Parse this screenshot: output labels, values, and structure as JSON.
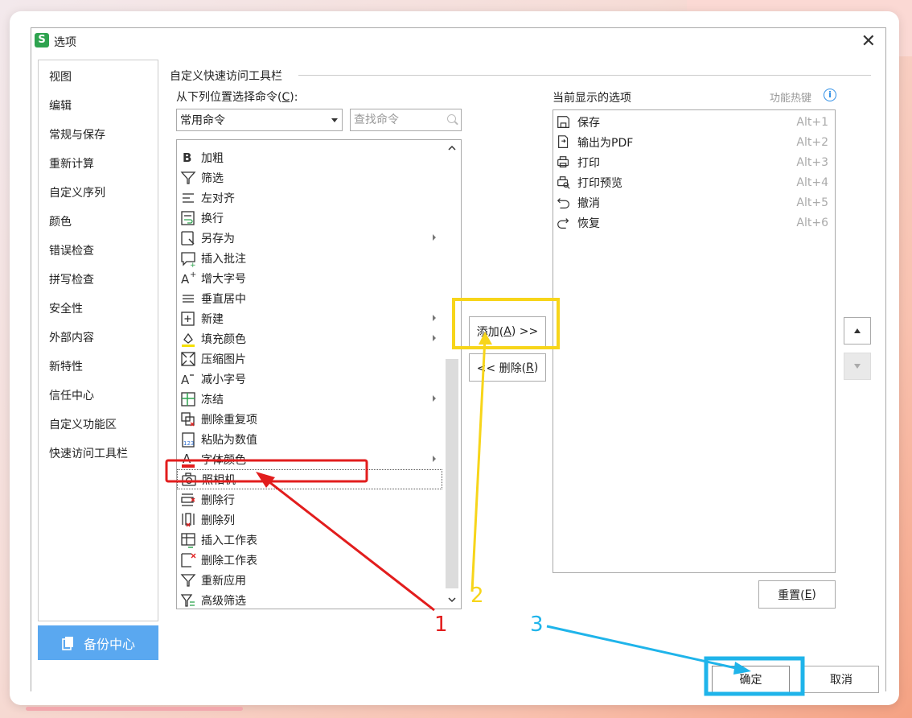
{
  "dialog": {
    "title": "选项",
    "app_icon_letter": "S",
    "close": "✕"
  },
  "nav": {
    "items": [
      "视图",
      "编辑",
      "常规与保存",
      "重新计算",
      "自定义序列",
      "颜色",
      "错误检查",
      "拼写检查",
      "安全性",
      "外部内容",
      "新特性",
      "信任中心",
      "自定义功能区",
      "快速访问工具栏"
    ],
    "backup_label": "备份中心"
  },
  "section": {
    "title": "自定义快速访问工具栏",
    "from_label_prefix": "从下列位置选择命令(",
    "from_label_key": "C",
    "from_label_suffix": "):",
    "combo_value": "常用命令",
    "search_placeholder": "查找命令",
    "current_label": "当前显示的选项",
    "hotkey_label": "功能热键",
    "info": "i"
  },
  "commands": [
    {
      "label": "加粗",
      "icon": "bold-icon",
      "submenu": false
    },
    {
      "label": "筛选",
      "icon": "filter-icon",
      "submenu": false
    },
    {
      "label": "左对齐",
      "icon": "align-left-icon",
      "submenu": false
    },
    {
      "label": "换行",
      "icon": "wrap-text-icon",
      "submenu": false
    },
    {
      "label": "另存为",
      "icon": "save-as-icon",
      "submenu": true
    },
    {
      "label": "插入批注",
      "icon": "comment-icon",
      "submenu": false
    },
    {
      "label": "增大字号",
      "icon": "font-increase-icon",
      "submenu": false
    },
    {
      "label": "垂直居中",
      "icon": "vertical-center-icon",
      "submenu": false
    },
    {
      "label": "新建",
      "icon": "new-icon",
      "submenu": true
    },
    {
      "label": "填充颜色",
      "icon": "fill-color-icon",
      "submenu": true
    },
    {
      "label": "压缩图片",
      "icon": "compress-image-icon",
      "submenu": false
    },
    {
      "label": "减小字号",
      "icon": "font-decrease-icon",
      "submenu": false
    },
    {
      "label": "冻结",
      "icon": "freeze-icon",
      "submenu": true
    },
    {
      "label": "删除重复项",
      "icon": "remove-duplicates-icon",
      "submenu": false
    },
    {
      "label": "粘贴为数值",
      "icon": "paste-values-icon",
      "submenu": false
    },
    {
      "label": "字体颜色",
      "icon": "font-color-icon",
      "submenu": true
    },
    {
      "label": "照相机",
      "icon": "camera-icon",
      "submenu": false
    },
    {
      "label": "删除行",
      "icon": "delete-row-icon",
      "submenu": false
    },
    {
      "label": "删除列",
      "icon": "delete-column-icon",
      "submenu": false
    },
    {
      "label": "插入工作表",
      "icon": "insert-sheet-icon",
      "submenu": false
    },
    {
      "label": "删除工作表",
      "icon": "delete-sheet-icon",
      "submenu": false
    },
    {
      "label": "重新应用",
      "icon": "reapply-icon",
      "submenu": false
    },
    {
      "label": "高级筛选",
      "icon": "advanced-filter-icon",
      "submenu": false
    }
  ],
  "selected_command_index": 16,
  "current": [
    {
      "label": "保存",
      "key": "Alt+1",
      "icon": "save-icon"
    },
    {
      "label": "输出为PDF",
      "key": "Alt+2",
      "icon": "export-pdf-icon"
    },
    {
      "label": "打印",
      "key": "Alt+3",
      "icon": "print-icon"
    },
    {
      "label": "打印预览",
      "key": "Alt+4",
      "icon": "print-preview-icon"
    },
    {
      "label": "撤消",
      "key": "Alt+5",
      "icon": "undo-icon"
    },
    {
      "label": "恢复",
      "key": "Alt+6",
      "icon": "redo-icon"
    }
  ],
  "buttons": {
    "add_prefix": "添加(",
    "add_key": "A",
    "add_suffix": ") >>",
    "del_prefix": "<< 删除(",
    "del_key": "R",
    "del_suffix": ")",
    "reset_prefix": "重置(",
    "reset_key": "E",
    "reset_suffix": ")",
    "ok": "确定",
    "cancel": "取消"
  },
  "annotations": {
    "label_1": "1",
    "label_2": "2",
    "label_3": "3",
    "color_1": "#e21d1d",
    "color_2": "#f7d51a",
    "color_3": "#1fb4ea"
  }
}
